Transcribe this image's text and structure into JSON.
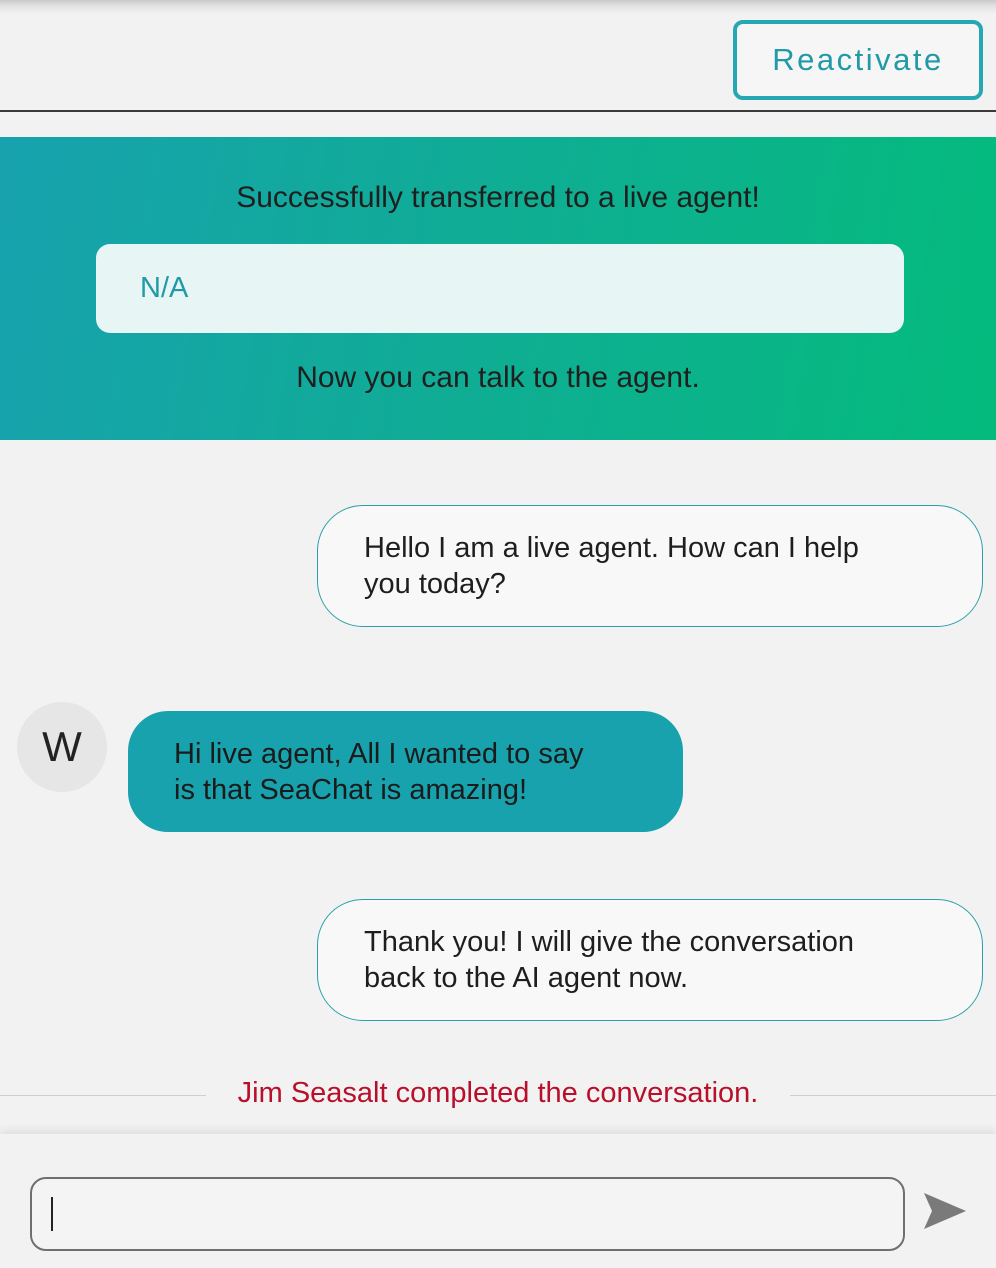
{
  "header": {
    "reactivate_label": "Reactivate"
  },
  "banner": {
    "title": "Successfully transferred to a live agent!",
    "info_value": "N/A",
    "subtitle": "Now you can talk to the agent."
  },
  "messages": [
    {
      "sender": "agent",
      "text_line1": "Hello I am a live agent. How can I help",
      "text_line2": "you today?"
    },
    {
      "sender": "user",
      "avatar_initial": "W",
      "text_line1": "Hi live agent, All I wanted to say",
      "text_line2": "is that SeaChat is amazing!"
    },
    {
      "sender": "agent",
      "text_line1": "Thank you! I will give the conversation",
      "text_line2": "back to the AI agent now."
    }
  ],
  "status": {
    "text": "Jim Seasalt completed the conversation."
  },
  "composer": {
    "input_value": "",
    "send_icon": "send-icon"
  },
  "colors": {
    "accent": "#1f9aa6",
    "banner_start": "#17a2ae",
    "banner_end": "#04bb7c",
    "status_red": "#b80f2a"
  }
}
